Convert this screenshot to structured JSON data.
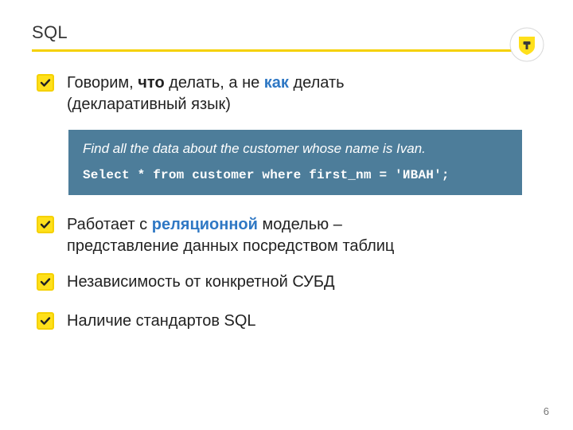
{
  "title": "SQL",
  "rule_color": "#f5d100",
  "bullets": [
    {
      "segments": [
        {
          "t": "Говорим, ",
          "cls": ""
        },
        {
          "t": "что",
          "cls": "emph-b"
        },
        {
          "t": " делать, а не ",
          "cls": ""
        },
        {
          "t": "как",
          "cls": "emph-c"
        },
        {
          "t": " делать (декларативный язык)",
          "cls": ""
        }
      ]
    },
    {
      "segments": [
        {
          "t": "Работает с ",
          "cls": ""
        },
        {
          "t": "реляционной",
          "cls": "emph-c"
        },
        {
          "t": " моделью – представление данных посредством таблиц",
          "cls": ""
        }
      ]
    },
    {
      "segments": [
        {
          "t": "Независимость от конкретной СУБД",
          "cls": ""
        }
      ]
    },
    {
      "segments": [
        {
          "t": "Наличие стандартов SQL",
          "cls": ""
        }
      ]
    }
  ],
  "code_block": {
    "caption": "Find all the data about the customer whose name is Ivan.",
    "sql": "Select * from customer where first_nm = 'ИВАН';"
  },
  "page_number": "6"
}
